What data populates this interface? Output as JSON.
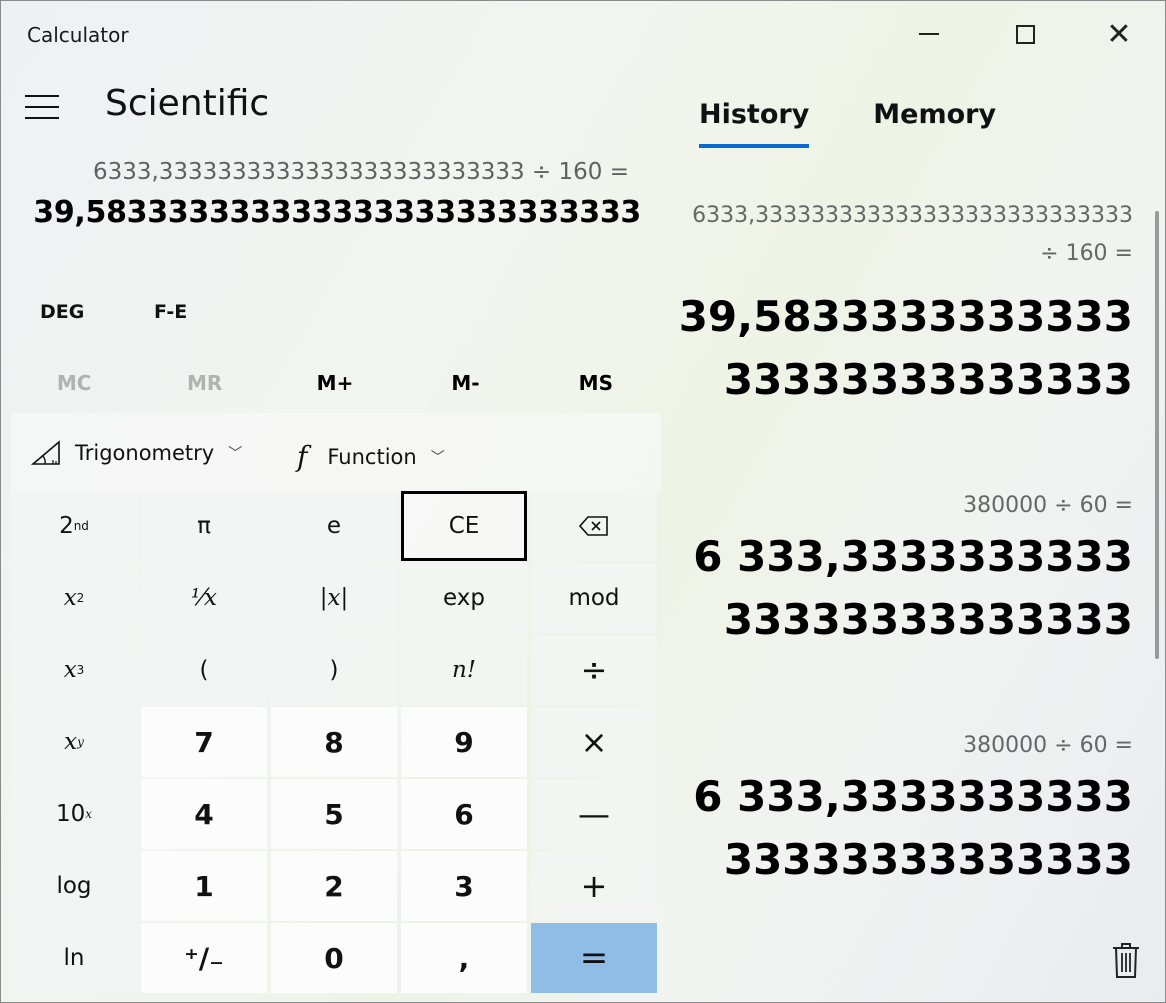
{
  "window": {
    "title": "Calculator",
    "minimize_glyph": "",
    "close_glyph": "✕"
  },
  "header": {
    "mode": "Scientific"
  },
  "display": {
    "expression": "6333,3333333333333333333333333 ÷ 160 =",
    "result": "39,583333333333333333333333333"
  },
  "mode_buttons": {
    "angle": "DEG",
    "fe": "F-E"
  },
  "memory_buttons": {
    "mc": "MC",
    "mr": "MR",
    "mplus": "M+",
    "mminus": "M-",
    "ms": "MS"
  },
  "function_bar": {
    "trigonometry": "Trigonometry",
    "function_glyph": "f",
    "function": "Function",
    "chevron": "﹀"
  },
  "keypad": {
    "second": "2",
    "second_sup": "nd",
    "pi": "π",
    "e": "e",
    "ce": "CE",
    "backspace_glyph": "⌫",
    "x_squared_base": "x",
    "x_squared_sup": "2",
    "reciprocal": "⅟x",
    "abs": "|x|",
    "exp": "exp",
    "mod": "mod",
    "x_cubed_base": "x",
    "x_cubed_sup": "3",
    "open_paren": "(",
    "close_paren": ")",
    "factorial": "n!",
    "divide": "÷",
    "x_pow_base": "x",
    "x_pow_sup": "y",
    "seven": "7",
    "eight": "8",
    "nine": "9",
    "multiply": "×",
    "ten_pow_base": "10",
    "ten_pow_sup": "x",
    "four": "4",
    "five": "5",
    "six": "6",
    "minus": "—",
    "log": "log",
    "one": "1",
    "two": "2",
    "three": "3",
    "plus": "+",
    "ln": "ln",
    "negate": "⁺∕₋",
    "zero": "0",
    "decimal": ",",
    "equals": "="
  },
  "side_panel": {
    "tabs": [
      "History",
      "Memory"
    ],
    "active_tab": "History",
    "history": [
      {
        "expression": "6333,333333333333333333333333333   ÷   160 =",
        "result": "39,583333333333333333333333333"
      },
      {
        "expression": "380000   ÷   60 =",
        "result": "6 333,333333333333333333333333"
      },
      {
        "expression": "380000   ÷   60 =",
        "result": "6 333,333333333333333333333333"
      }
    ]
  },
  "colors": {
    "accent": "#0a6ad3",
    "equals_key": "#8fbde6"
  }
}
